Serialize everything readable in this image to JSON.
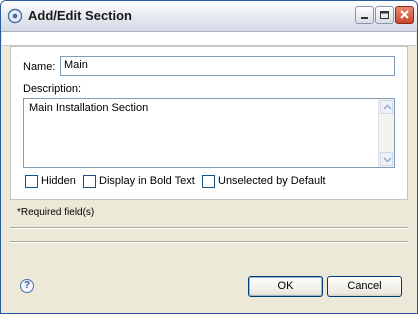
{
  "window": {
    "title": "Add/Edit Section"
  },
  "form": {
    "name_label": "Name:",
    "name_value": "Main",
    "description_label": "Description:",
    "description_value": "Main Installation Section",
    "checkboxes": [
      {
        "label": "Hidden",
        "checked": false
      },
      {
        "label": "Display in Bold Text",
        "checked": false
      },
      {
        "label": "Unselected by Default",
        "checked": false
      }
    ],
    "required_note": "*Required field(s)"
  },
  "footer": {
    "help_glyph": "?",
    "ok_label": "OK",
    "cancel_label": "Cancel"
  },
  "icons": [
    "app-icon",
    "minimize-icon",
    "maximize-icon",
    "close-icon",
    "help-icon"
  ],
  "colors": {
    "frame": "#2a5aa0",
    "dialog_bg": "#ece9d8",
    "input_border": "#7f9db9",
    "checkbox_border": "#1c5180"
  }
}
